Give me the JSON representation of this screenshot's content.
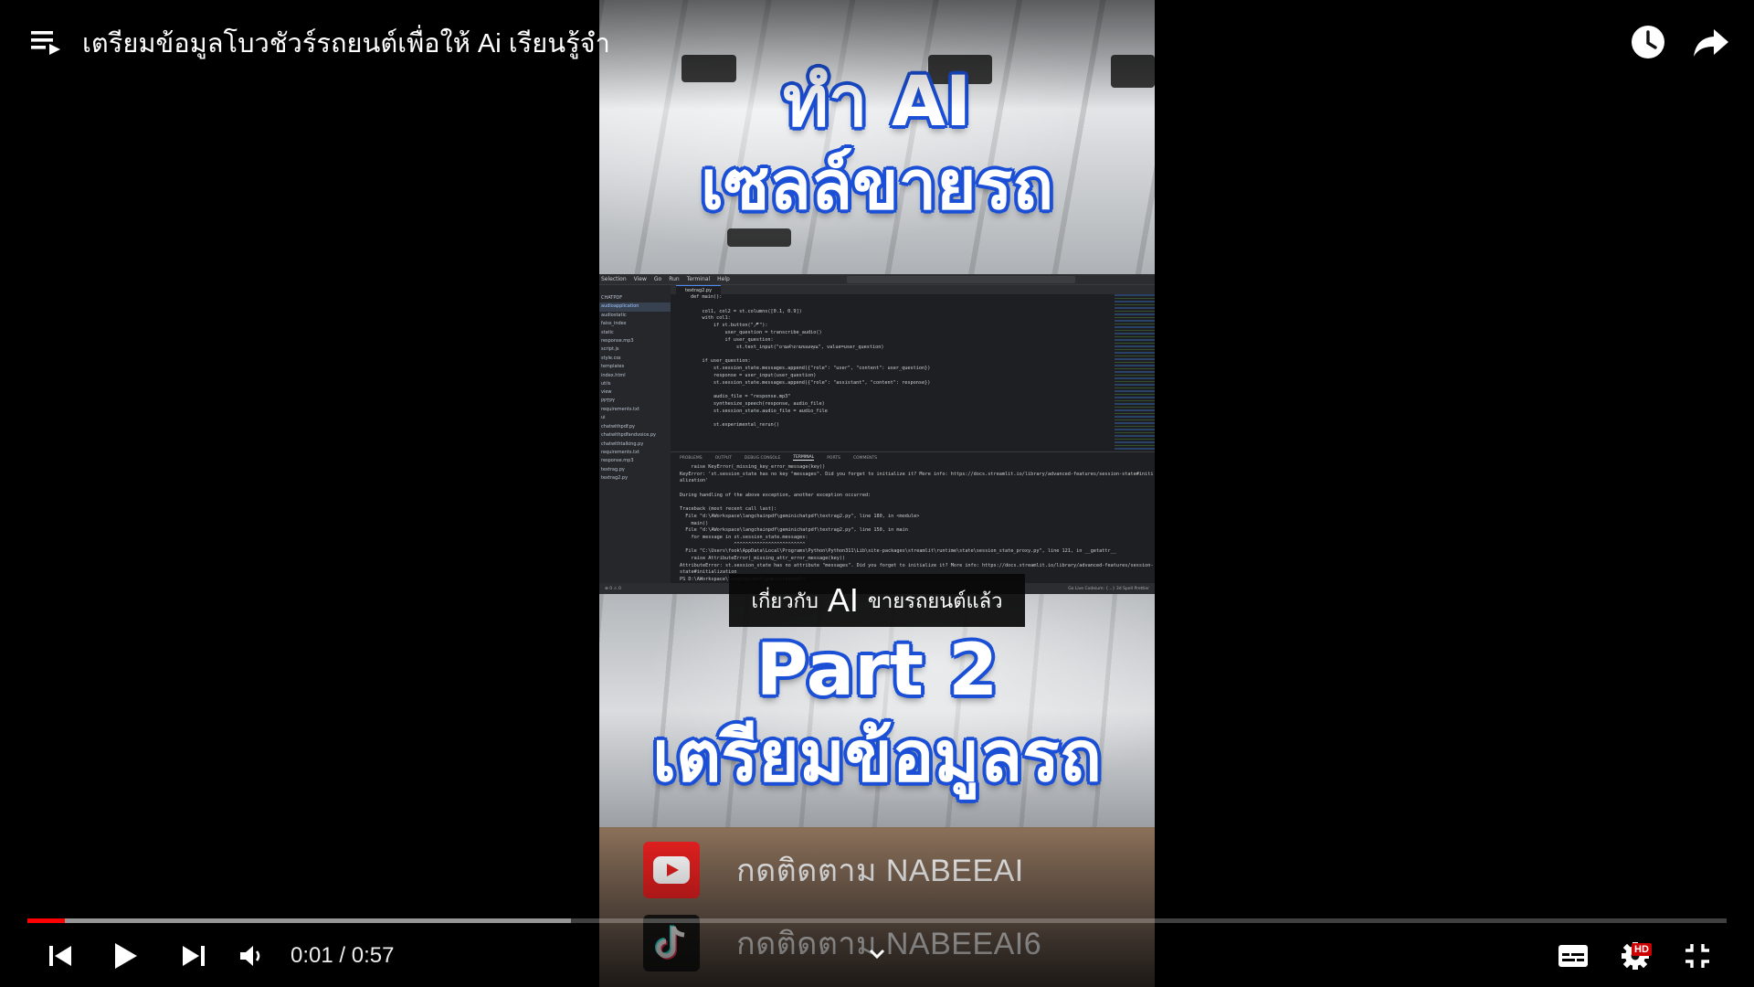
{
  "player": {
    "video_title": "เตรียมข้อมูลโบวชัวร์รถยนต์เพื่อให้ Ai เรียนรู้จำ",
    "time_current": "0:01",
    "time_separator": " / ",
    "time_total": "0:57",
    "progress_played": 0.022,
    "progress_buffered": 0.32,
    "hd_badge": "HD",
    "accent_color": "#ff0000",
    "icons": {
      "playlist": "playlist-icon",
      "watch_later": "clock-icon",
      "share": "share-icon",
      "previous": "previous-icon",
      "play": "play-icon",
      "next": "next-icon",
      "volume": "volume-icon",
      "subtitles": "subtitles-icon",
      "settings": "settings-icon",
      "fullscreen_exit": "exit-fullscreen-icon"
    }
  },
  "video_frame": {
    "title_line1": "ทำ AI",
    "title_line2": "เซลล์ขายรถ",
    "part_line1": "Part 2",
    "part_line2": "เตรียมข้อมูลรถ",
    "caption_before": "เกี่ยวกับ",
    "caption_big": "AI",
    "caption_after": "ขายรถยนต์แล้ว",
    "youtube_follow": "กดติดตาม NABEEAI",
    "tiktok_follow": "กดติดตาม NABEEAI6",
    "highlight_color": "#1a4fd6",
    "editor": {
      "menu": [
        "Selection",
        "View",
        "Go",
        "Run",
        "Terminal",
        "Help"
      ],
      "tab": "textrag2.py",
      "breadcrumb": "textrag2.py > main",
      "explorer": [
        "CHATPDF",
        "audioapplication",
        "audiostatic",
        "faiss_index",
        "static",
        "response.mp3",
        "script.js",
        "style.css",
        "templates",
        "index.html",
        "utils",
        "view",
        "PPTPY",
        "requirements.txt",
        "ui",
        "chatwithpdf.py",
        "chatwithpdfandvoice.py",
        "chatwithtalking.py",
        "requirements.txt",
        "response.mp3",
        "textrag.py",
        "textrag2.py"
      ],
      "code_lines": [
        "def main():",
        "",
        "    col1, col2 = st.columns([0.1, 0.9])",
        "    with col1:",
        "        if st.button(\"🎤\"):",
        "            user_question = transcribe_audio()",
        "            if user_question:",
        "                st.text_input(\"ถามคำถามของคุณ\", value=user_question)",
        "",
        "    if user_question:",
        "        st.session_state.messages.append({\"role\": \"user\", \"content\": user_question})",
        "        response = user_input(user_question)",
        "        st.session_state.messages.append({\"role\": \"assistant\", \"content\": response})",
        "",
        "        audio_file = \"response.mp3\"",
        "        synthesize_speech(response, audio_file)",
        "        st.session_state.audio_file = audio_file",
        "",
        "        st.experimental_rerun()"
      ],
      "panel_tabs": [
        "PROBLEMS",
        "OUTPUT",
        "DEBUG CONSOLE",
        "TERMINAL",
        "PORTS",
        "COMMENTS"
      ],
      "terminal_lines": [
        "    raise KeyError(_missing_key_error_message(key))",
        "KeyError: 'st.session_state has no key \"messages\". Did you forget to initialize it? More info: https://docs.streamlit.io/library/advanced-features/session-state#initi",
        "alization'",
        "",
        "During handling of the above exception, another exception occurred:",
        "",
        "Traceback (most recent call last):",
        "  File \"d:\\AWorkspace\\langchainpdf\\geminichatpdf\\textrag2.py\", line 180, in <module>",
        "    main()",
        "  File \"d:\\AWorkspace\\langchainpdf\\geminichatpdf\\textrag2.py\", line 150, in main",
        "    for message in st.session_state.messages:",
        "                   ^^^^^^^^^^^^^^^^^^^^^^^^^",
        "  File \"C:\\Users\\fook\\AppData\\Local\\Programs\\Python\\Python311\\Lib\\site-packages\\streamlit\\runtime\\state\\session_state_proxy.py\", line 121, in __getattr__",
        "    raise AttributeError(_missing_attr_error_message(key))",
        "AttributeError: st.session_state has no attribute \"messages\". Did you forget to initialize it? More info: https://docs.streamlit.io/library/advanced-features/session-",
        "state#initialization",
        "PS D:\\AWorkspace\\langchainpdf\\geminichatpdf> "
      ],
      "status_right": "Go Live   Codeium: {...}   3d Spell   Prettier"
    }
  }
}
